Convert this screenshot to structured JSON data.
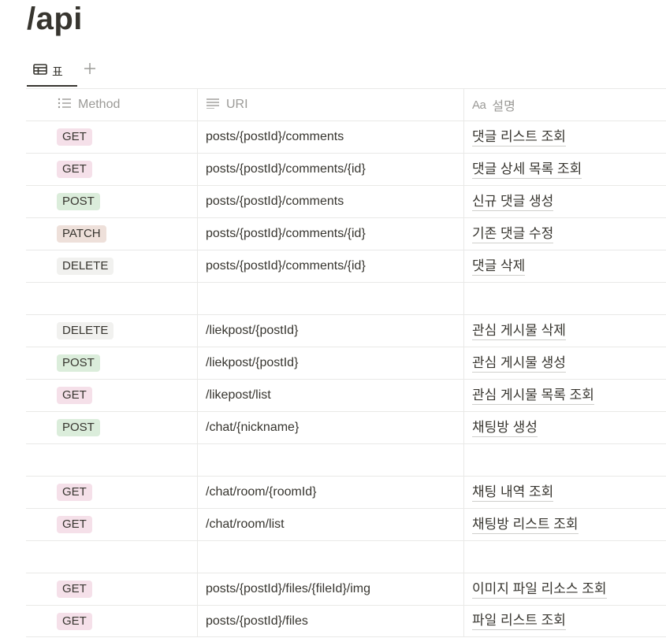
{
  "page": {
    "title": "/api"
  },
  "view": {
    "tab_label": "표",
    "add_label": "+"
  },
  "columns": {
    "method": "Method",
    "uri": "URI",
    "desc_icon": "Aa",
    "desc": "설명"
  },
  "colors": {
    "GET": "#f5e0e9",
    "POST": "#dbeddb",
    "PATCH": "#eee0da",
    "DELETE": "#f1f1ef"
  },
  "rows": [
    {
      "method": "GET",
      "uri": "posts/{postId}/comments",
      "desc": "댓글 리스트 조회"
    },
    {
      "method": "GET",
      "uri": "posts/{postId}/comments/{id}",
      "desc": "댓글 상세 목록 조회"
    },
    {
      "method": "POST",
      "uri": "posts/{postId}/comments",
      "desc": "신규 댓글 생성"
    },
    {
      "method": "PATCH",
      "uri": "posts/{postId}/comments/{id}",
      "desc": "기존 댓글 수정"
    },
    {
      "method": "DELETE",
      "uri": "posts/{postId}/comments/{id}",
      "desc": "댓글 삭제"
    },
    {
      "method": "",
      "uri": "",
      "desc": ""
    },
    {
      "method": "DELETE",
      "uri": "/liekpost/{postId}",
      "desc": "관심 게시물 삭제"
    },
    {
      "method": "POST",
      "uri": "/liekpost/{postId}",
      "desc": "관심 게시물 생성"
    },
    {
      "method": "GET",
      "uri": "/likepost/list",
      "desc": "관심 게시물 목록 조회"
    },
    {
      "method": "POST",
      "uri": "/chat/{nickname}",
      "desc": "채팅방 생성"
    },
    {
      "method": "",
      "uri": "",
      "desc": ""
    },
    {
      "method": "GET",
      "uri": "/chat/room/{roomId}",
      "desc": "채팅 내역 조회"
    },
    {
      "method": "GET",
      "uri": "/chat/room/list",
      "desc": "채팅방 리스트 조회"
    },
    {
      "method": "",
      "uri": "",
      "desc": ""
    },
    {
      "method": "GET",
      "uri": "posts/{postId}/files/{fileId}/img",
      "desc": "이미지 파일 리소스 조회"
    },
    {
      "method": "GET",
      "uri": "posts/{postId}/files",
      "desc": "파일 리스트 조회"
    }
  ]
}
